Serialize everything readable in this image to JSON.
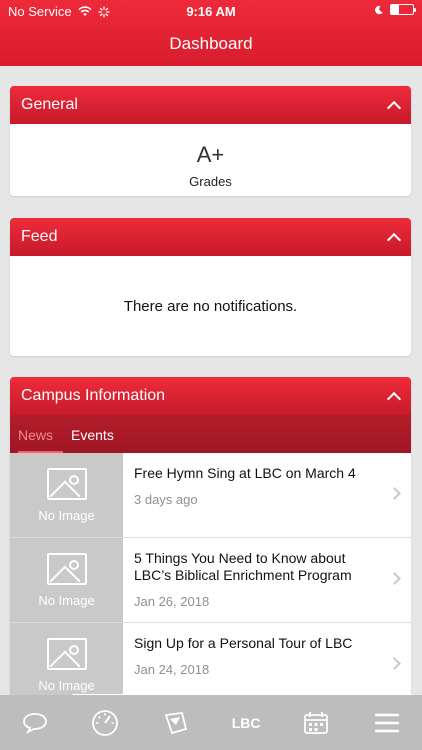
{
  "status": {
    "carrier": "No Service",
    "time": "9:16 AM"
  },
  "header": {
    "title": "Dashboard"
  },
  "general": {
    "title": "General",
    "grade_value": "A+",
    "grade_label": "Grades"
  },
  "feed": {
    "title": "Feed",
    "empty_message": "There are no notifications."
  },
  "campus": {
    "title": "Campus Information",
    "tabs": [
      {
        "label": "News",
        "active": true
      },
      {
        "label": "Events",
        "active": false
      }
    ],
    "news": [
      {
        "thumb_label": "No Image",
        "title": "Free Hymn Sing at LBC on March 4",
        "date": "3 days ago"
      },
      {
        "thumb_label": "No Image",
        "title": "5 Things You Need to Know about LBC’s Biblical Enrichment Program",
        "date": "Jan 26, 2018"
      },
      {
        "thumb_label": "No Image",
        "title": "Sign Up for a Personal Tour of LBC",
        "date": "Jan 24, 2018"
      }
    ]
  },
  "tabbar": {
    "items": [
      {
        "icon": "chat-bubble-icon"
      },
      {
        "icon": "dashboard-gauge-icon"
      },
      {
        "icon": "graduation-icon"
      },
      {
        "icon": "lbc-logo",
        "label": "LBC"
      },
      {
        "icon": "calendar-icon"
      },
      {
        "icon": "menu-icon"
      }
    ]
  },
  "colors": {
    "brand_red": "#e8202f",
    "tabbar_gray": "#bdbdbd"
  }
}
